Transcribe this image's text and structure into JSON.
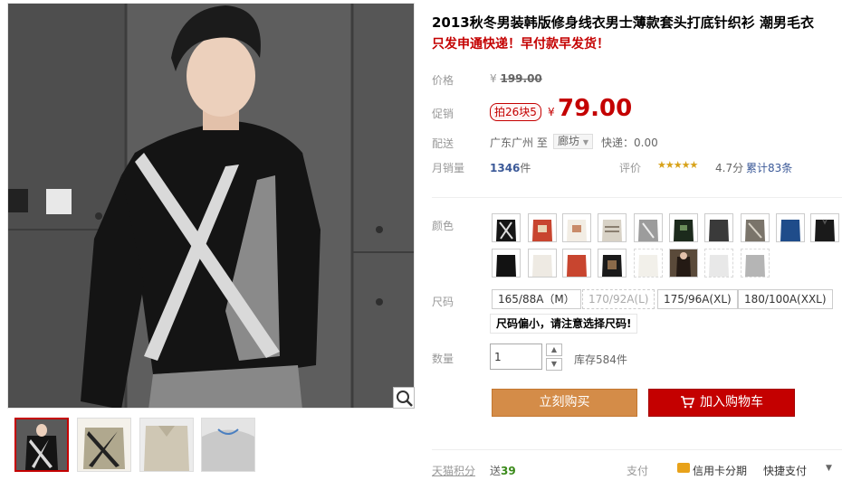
{
  "product": {
    "title": "2013秋冬男装韩版修身线衣男士薄款套头打底针织衫 潮男毛衣",
    "promo_text": "只发申通快递！早付款早发货！"
  },
  "price": {
    "original_label": "价格",
    "currency": "¥",
    "original": "199.00",
    "promo_label": "促销",
    "promo_tag": "拍26块5",
    "promo": "79.00"
  },
  "delivery": {
    "label": "配送",
    "from": "广东广州 至",
    "to": "廊坊",
    "fee": "快递：0.00"
  },
  "sales": {
    "label": "月销量",
    "count": "1346",
    "unit": "件"
  },
  "rating": {
    "label": "评价",
    "stars": "★★★★★",
    "score": "4.7分",
    "total": "累计83条"
  },
  "colors": {
    "label": "颜色"
  },
  "sizes": {
    "label": "尺码",
    "options": [
      "165/88A（M）",
      "170/92A(L)",
      "175/96A(XL)",
      "180/100A(XXL)"
    ],
    "tip": "尺码偏小，请注意选择尺码!"
  },
  "quantity": {
    "label": "数量",
    "value": "1",
    "stock": "库存584件"
  },
  "actions": {
    "buy_now": "立刻购买",
    "add_to_cart": "加入购物车"
  },
  "footer": {
    "points_label": "天猫积分",
    "points_prefix": "送",
    "points_value": "39",
    "pay_label": "支付",
    "credit": "信用卡分期",
    "quick_pay": "快捷支付"
  },
  "accent": "#c40000"
}
